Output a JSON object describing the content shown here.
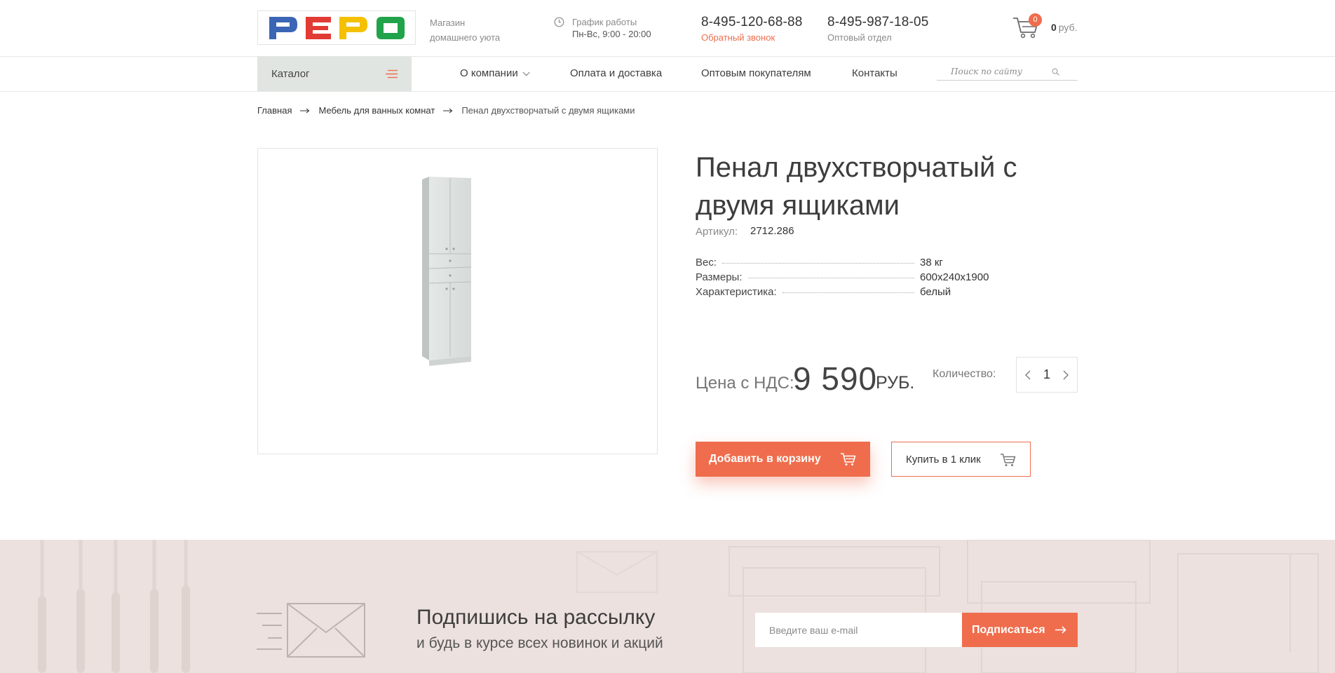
{
  "header": {
    "logo_text": "PEPO",
    "shop_tagline": "Магазин домашнего уюта",
    "hours_title": "График работы",
    "hours_value": "Пн-Вс, 9:00 - 20:00",
    "phone1": "8-495-120-68-88",
    "phone1_sub": "Обратный звонок",
    "phone2": "8-495-987-18-05",
    "phone2_sub": "Оптовый отдел",
    "cart_count": "0",
    "cart_total_value": "0",
    "cart_total_currency": "руб."
  },
  "nav": {
    "catalog_label": "Каталог",
    "items": [
      {
        "label": "О компании"
      },
      {
        "label": "Оплата и доставка"
      },
      {
        "label": "Оптовым покупателям"
      },
      {
        "label": "Контакты"
      }
    ],
    "search_placeholder": "Поиск по сайту"
  },
  "breadcrumb": {
    "items": [
      "Главная",
      "Мебель для ванных комнат"
    ],
    "current": "Пенал двухстворчатый с двумя ящиками"
  },
  "product": {
    "title": "Пенал двухстворчатый с двумя ящиками",
    "sku_label": "Артикул:",
    "sku_value": "2712.286",
    "specs": [
      {
        "name": "Вес:",
        "value": "38 кг"
      },
      {
        "name": "Размеры:",
        "value": "600x240x1900"
      },
      {
        "name": "Характеристика:",
        "value": "белый"
      }
    ],
    "price_label": "Цена с НДС:",
    "price_value": "9 590",
    "price_currency": "РУБ.",
    "quantity_label": "Количество:",
    "quantity_value": "1",
    "add_to_cart_label": "Добавить в корзину",
    "buy_one_click_label": "Купить в 1 клик"
  },
  "subscribe": {
    "title": "Подпишись на рассылку",
    "text": "и будь в курсе всех новинок и акций",
    "email_placeholder": "Введите ваш e-mail",
    "button_label": "Подписаться"
  },
  "colors": {
    "accent": "#ef6d4d",
    "catalog_bg": "#e0e5e2",
    "subscribe_bg": "#ece1de",
    "logo_blue": "#3b66b5",
    "logo_red": "#e23a34",
    "logo_yellow": "#f5c000",
    "logo_green": "#20a34a"
  }
}
